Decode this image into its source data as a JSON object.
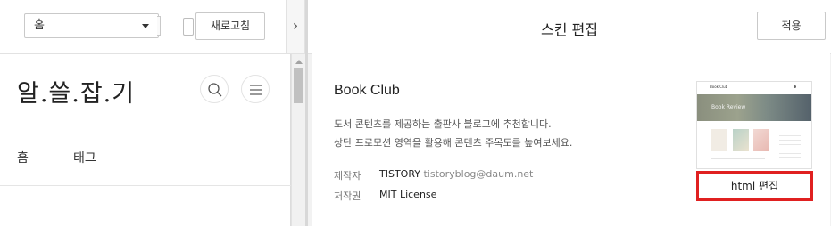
{
  "left": {
    "page_select": {
      "value": "홈"
    },
    "refresh_label": "새로고침",
    "blog_title": "알.쓸.잡.기",
    "nav": [
      {
        "label": "홈"
      },
      {
        "label": "태그"
      }
    ],
    "collapse_glyph": "›"
  },
  "right": {
    "header_title": "스킨 편집",
    "apply_label": "적용",
    "skin": {
      "name": "Book Club",
      "description": [
        "도서 콘텐츠를 제공하는 출판사 블로그에 추천합니다.",
        "상단 프로모션 영역을 활용해 콘텐츠 주목도를 높여보세요."
      ],
      "author_label": "제작자",
      "author_name": "TISTORY",
      "author_email": "tistoryblog@daum.net",
      "license_label": "저작권",
      "license_value": "MIT License",
      "html_edit_label": "html 편집",
      "thumbnail": {
        "title": "Book Club",
        "hero_text": "Book Review"
      }
    }
  },
  "colors": {
    "highlight_border": "#e02020",
    "pane_background": "#f2f2f2"
  }
}
